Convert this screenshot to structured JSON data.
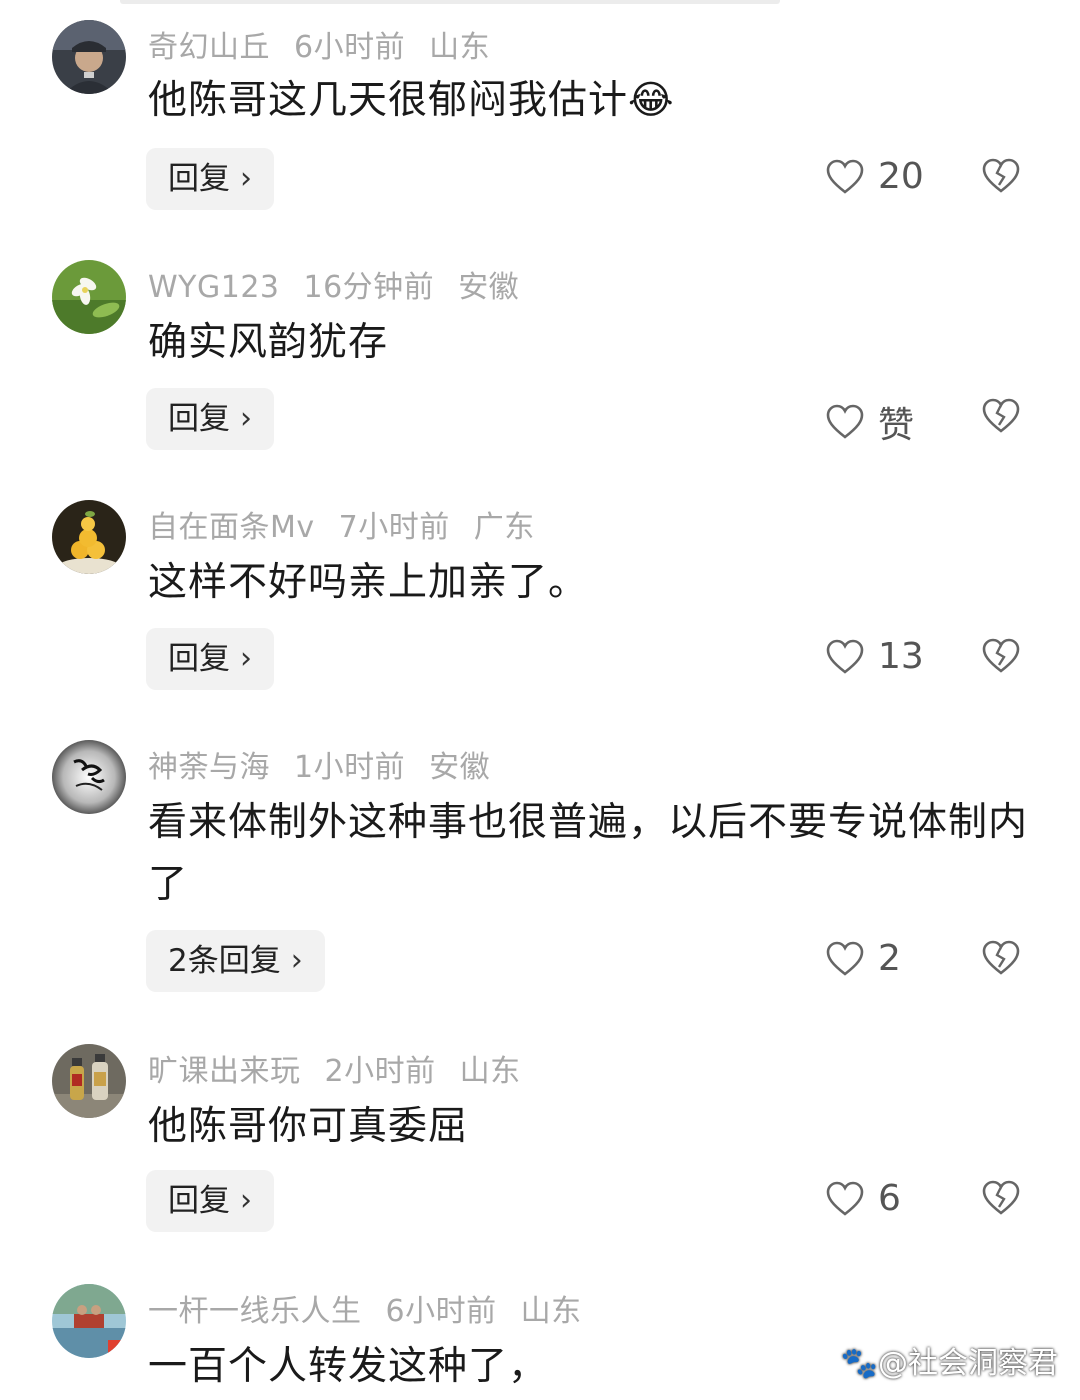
{
  "comments": [
    {
      "user": "奇幻山丘",
      "time": "6小时前",
      "region": "山东",
      "text": "他陈哥这几天很郁闷我估计",
      "emoji": "😂",
      "reply_label": "回复",
      "likes": "20",
      "avatar": "soldier-portrait-avatar"
    },
    {
      "user": "WYG123",
      "time": "16分钟前",
      "region": "安徽",
      "text": "确实风韵犹存",
      "reply_label": "回复",
      "likes": "赞",
      "avatar": "white-flower-avatar"
    },
    {
      "user": "自在面条Mv",
      "time": "7小时前",
      "region": "广东",
      "text": "这样不好吗亲上加亲了。",
      "reply_label": "回复",
      "likes": "13",
      "avatar": "yellow-food-avatar"
    },
    {
      "user": "神荼与海",
      "time": "1小时前",
      "region": "安徽",
      "text": "看来体制外这种事也很普遍，以后不要专说体制内了",
      "reply_label": "2条回复",
      "likes": "2",
      "avatar": "calligraphy-avatar"
    },
    {
      "user": "旷课出来玩",
      "time": "2小时前",
      "region": "山东",
      "text": "他陈哥你可真委屈",
      "reply_label": "回复",
      "likes": "6",
      "avatar": "bottles-avatar"
    },
    {
      "user": "一杆一线乐人生",
      "time": "6小时前",
      "region": "山东",
      "text": "一百个人转发这种了，",
      "avatar": "lake-scene-avatar"
    }
  ],
  "watermark": "@社会洞察君",
  "colors": {
    "meta": "#a8a8a8",
    "text": "#1a1a1a",
    "reply_bg": "#f2f2f2"
  }
}
